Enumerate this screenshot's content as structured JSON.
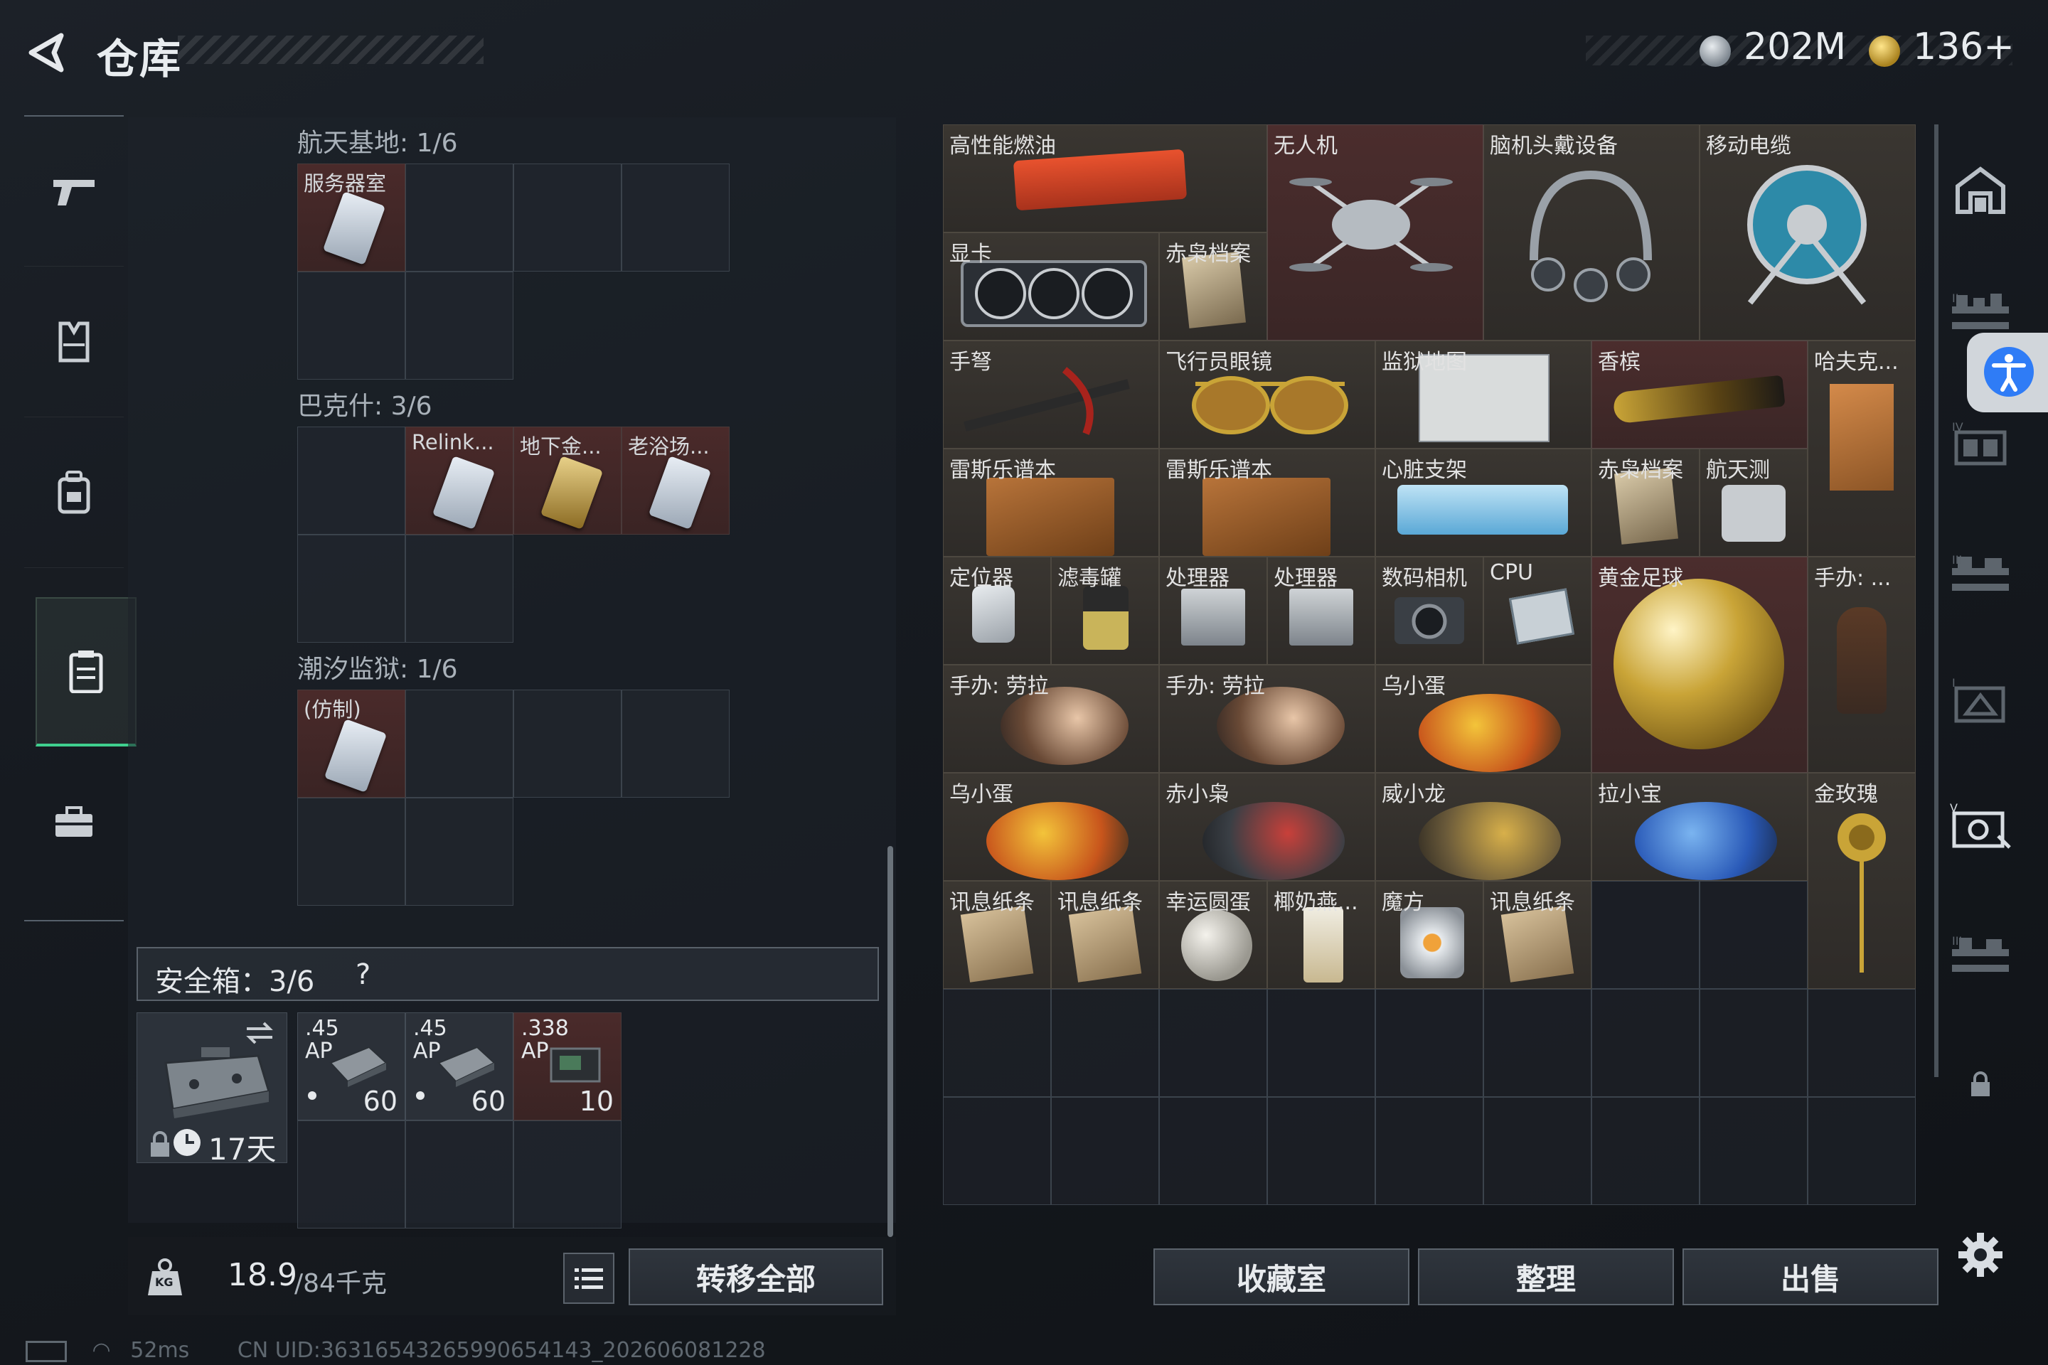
{
  "header": {
    "title": "仓库",
    "currency": [
      {
        "icon": "silver-coin-icon",
        "value": "202M"
      },
      {
        "icon": "gold-coin-icon",
        "value": "136+"
      }
    ]
  },
  "left_nav": [
    {
      "icon": "pistol-icon"
    },
    {
      "icon": "vest-icon"
    },
    {
      "icon": "backpack-icon"
    },
    {
      "icon": "clipboard-icon"
    },
    {
      "icon": "briefcase-icon"
    }
  ],
  "collections": {
    "s1": {
      "label": "航天基地: 1/6",
      "items": [
        "服务器室"
      ]
    },
    "s2": {
      "label": "巴克什: 3/6",
      "items": [
        "Relink...",
        "地下金...",
        "老浴场..."
      ]
    },
    "s3": {
      "label": "潮汐监狱: 1/6",
      "items": [
        "(仿制)"
      ]
    }
  },
  "safe_box": {
    "label": "安全箱：3/6",
    "help": "?",
    "timer": "17天",
    "ammo": [
      {
        "caliber": ".45",
        "type": "AP",
        "count": "60"
      },
      {
        "caliber": ".45",
        "type": "AP",
        "count": "60"
      },
      {
        "caliber": ".338",
        "type": "AP",
        "count": "10"
      }
    ]
  },
  "weight": {
    "value": "18.9",
    "capacity": "/84千克",
    "icon_text": "KG"
  },
  "buttons": {
    "transfer_all": "转移全部",
    "collection": "收藏室",
    "organize": "整理",
    "sell": "出售"
  },
  "items": {
    "fuel": "高性能燃油",
    "drone": "无人机",
    "headset": "脑机头戴设备",
    "reel": "移动电缆",
    "gpu": "显卡",
    "file1": "赤枭档案",
    "crossbow": "手弩",
    "goggles": "飞行员眼镜",
    "map": "监狱地图",
    "champagne": "香槟",
    "hafke": "哈夫克...",
    "book1": "雷斯乐谱本",
    "book2": "雷斯乐谱本",
    "stent": "心脏支架",
    "file2": "赤枭档案",
    "aero": "航天测",
    "locator": "定位器",
    "filter": "滤毒罐",
    "cpu1": "处理器",
    "cpu2": "处理器",
    "camera": "数码相机",
    "cpu": "CPU",
    "football": "黄金足球",
    "fig_side": "手办: ...",
    "fig1": "手办: 劳拉",
    "fig2": "手办: 劳拉",
    "egg1": "乌小蛋",
    "egg2": "乌小蛋",
    "chixiao": "赤小枭",
    "weilong": "威小龙",
    "laxiao": "拉小宝",
    "rose": "金玫瑰",
    "note1": "讯息纸条",
    "note2": "讯息纸条",
    "lucky": "幸运圆蛋",
    "coco": "椰奶燕...",
    "cube": "魔方",
    "note3": "讯息纸条"
  },
  "status": {
    "ping": "52ms",
    "uid": "CN UID:36316543265990654143_202606081228"
  },
  "colors": {
    "accent_green": "#3fcf8e",
    "rare_red": "#4b2d2d",
    "gold": "#c9a437"
  }
}
